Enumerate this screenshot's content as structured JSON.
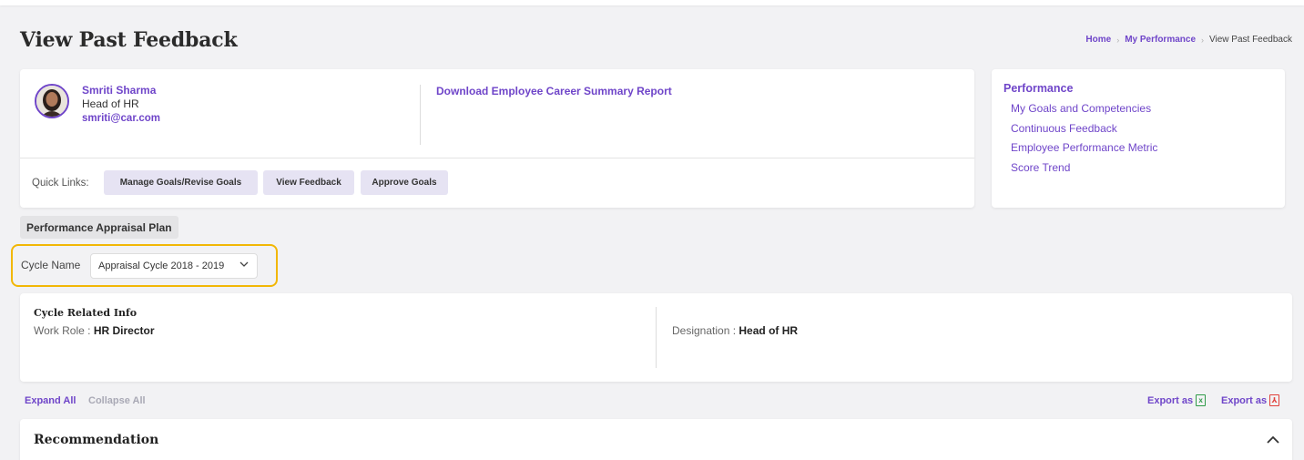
{
  "page": {
    "title": "View Past Feedback"
  },
  "breadcrumb": {
    "items": [
      "Home",
      "My Performance",
      "View Past Feedback"
    ],
    "separator": ">"
  },
  "profile": {
    "name": "Smriti Sharma",
    "role": "Head of HR",
    "email": "smriti@car.com",
    "download_link": "Download Employee Career Summary Report"
  },
  "quick_links": {
    "label": "Quick Links:",
    "buttons": [
      "Manage Goals/Revise Goals",
      "View Feedback",
      "Approve Goals"
    ]
  },
  "sidebar": {
    "title": "Performance",
    "links": [
      "My Goals and Competencies",
      "Continuous Feedback",
      "Employee Performance Metric",
      "Score Trend"
    ]
  },
  "plan": {
    "tag": "Performance Appraisal Plan",
    "cycle_label": "Cycle Name",
    "cycle_value": "Appraisal Cycle 2018 - 2019"
  },
  "cycle_info": {
    "title": "Cycle Related Info",
    "work_role_label": "Work Role :",
    "work_role_value": "HR Director",
    "designation_label": "Designation :",
    "designation_value": "Head of HR"
  },
  "actions": {
    "expand_all": "Expand All",
    "collapse_all": "Collapse All",
    "export_excel": "Export as",
    "export_pdf": "Export as"
  },
  "recommendation": {
    "title": "Recommendation"
  },
  "colors": {
    "accent": "#6f45c9",
    "highlight": "#f2b705",
    "background": "#f2f2f4",
    "quick_link_bg": "#e6e3f3"
  }
}
